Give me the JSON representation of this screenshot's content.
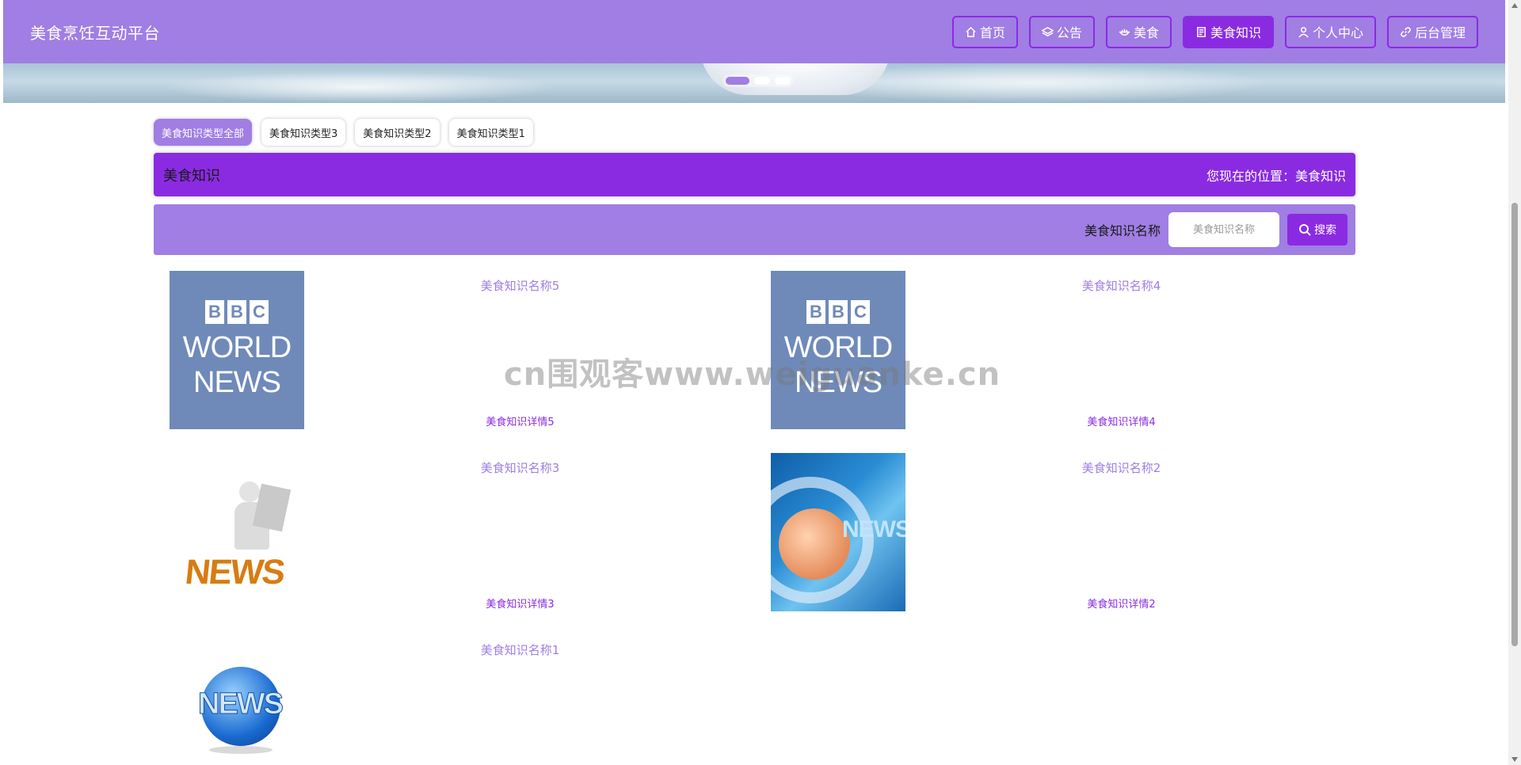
{
  "site": {
    "title": "美食烹饪互动平台"
  },
  "nav": [
    {
      "label": "首页",
      "icon": "home-icon",
      "active": false
    },
    {
      "label": "公告",
      "icon": "layers-icon",
      "active": false
    },
    {
      "label": "美食",
      "icon": "bowl-icon",
      "active": false
    },
    {
      "label": "美食知识",
      "icon": "document-icon",
      "active": true
    },
    {
      "label": "个人中心",
      "icon": "user-icon",
      "active": false
    },
    {
      "label": "后台管理",
      "icon": "link-icon",
      "active": false
    }
  ],
  "carousel": {
    "slides": 3,
    "active": 0
  },
  "tabs": [
    {
      "label": "美食知识类型全部",
      "active": true
    },
    {
      "label": "美食知识类型3",
      "active": false
    },
    {
      "label": "美食知识类型2",
      "active": false
    },
    {
      "label": "美食知识类型1",
      "active": false
    }
  ],
  "section": {
    "title": "美食知识",
    "location": "您现在的位置：美食知识"
  },
  "search": {
    "label": "美食知识名称",
    "placeholder": "美食知识名称",
    "button": "搜索"
  },
  "items": [
    {
      "name": "美食知识名称5",
      "detail": "美食知识详情5",
      "image": "bbc-world-news"
    },
    {
      "name": "美食知识名称4",
      "detail": "美食知识详情4",
      "image": "bbc-world-news"
    },
    {
      "name": "美食知识名称3",
      "detail": "美食知识详情3",
      "image": "news-figure"
    },
    {
      "name": "美食知识名称2",
      "detail": "美食知识详情2",
      "image": "news-blue"
    },
    {
      "name": "美食知识名称1",
      "detail": "",
      "image": "news-globe"
    }
  ],
  "image_text": {
    "bbc_letters": [
      "B",
      "B",
      "C"
    ],
    "bbc_line1": "WORLD",
    "bbc_line2": "NEWS",
    "news": "NEWS"
  },
  "watermark": "cn围观客www.weiguanke.cn",
  "colors": {
    "header": "#a07ee3",
    "accent": "#8a2be2",
    "link": "#a07ee3"
  }
}
